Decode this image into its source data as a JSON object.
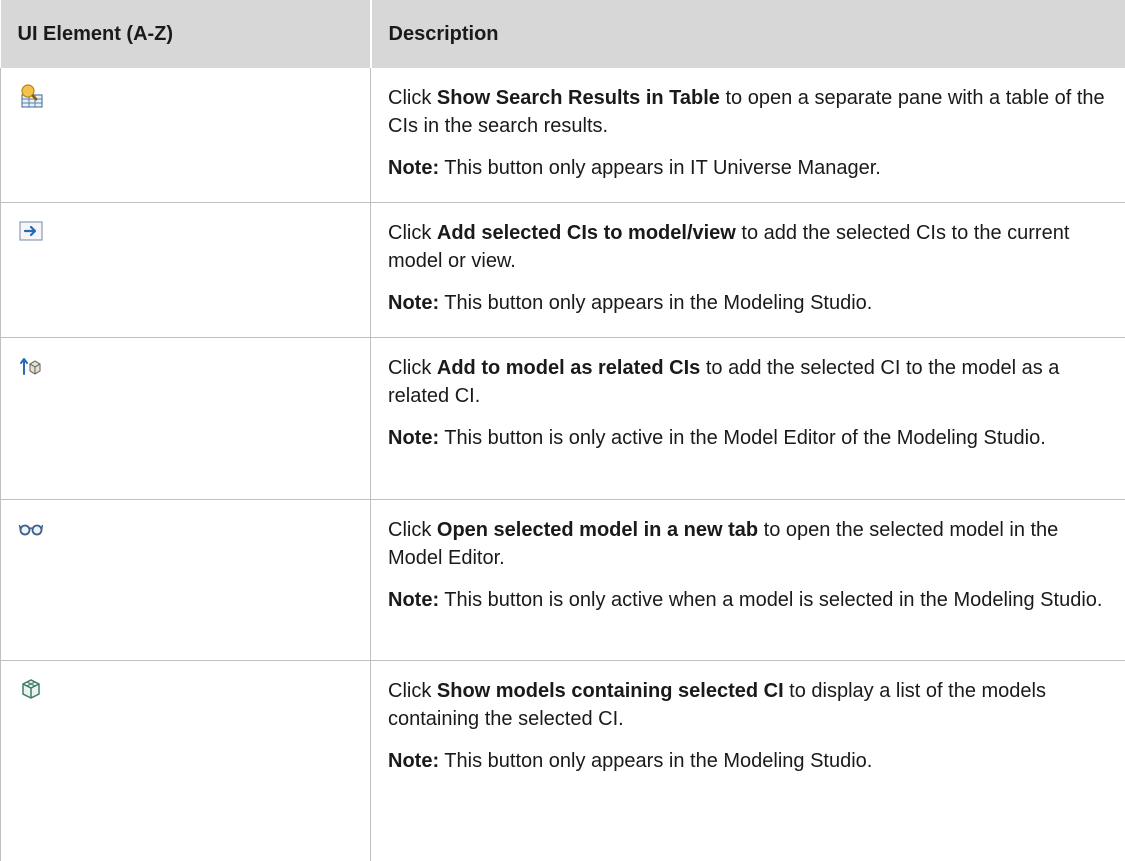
{
  "table": {
    "headers": {
      "element": "UI Element (A-Z)",
      "description": "Description"
    },
    "rows": [
      {
        "icon": "show-search-results-in-table-icon",
        "intro": "Click ",
        "name": "Show Search Results in Table",
        "rest": " to open a separate pane with a table of the CIs in the search results.",
        "note_label": "Note:",
        "note_text": " This button only appears in IT Universe Manager."
      },
      {
        "icon": "add-selected-cis-arrow-icon",
        "intro": "Click ",
        "name": "Add selected CIs to model/view",
        "rest": " to add the selected CIs to the current model or view.",
        "note_label": "Note:",
        "note_text": " This button only appears in the Modeling Studio."
      },
      {
        "icon": "add-related-cis-icon",
        "intro": "Click ",
        "name": "Add to model as related CIs",
        "rest": " to add the selected CI to the model as a related CI.",
        "note_label": "Note:",
        "note_text": " This button is only active in the Model Editor of the Modeling Studio."
      },
      {
        "icon": "glasses-open-model-icon",
        "intro": "Click ",
        "name": "Open selected model in a new tab",
        "rest": " to open the selected model in the Model Editor.",
        "note_label": "Note:",
        "note_text": " This button is only active when a model is selected in the Modeling Studio."
      },
      {
        "icon": "cube-models-icon",
        "intro": "Click ",
        "name": "Show models containing selected CI",
        "rest": " to display a list of the models containing the selected CI.",
        "note_label": "Note:",
        "note_text": " This button only appears in the Modeling Studio."
      }
    ]
  }
}
